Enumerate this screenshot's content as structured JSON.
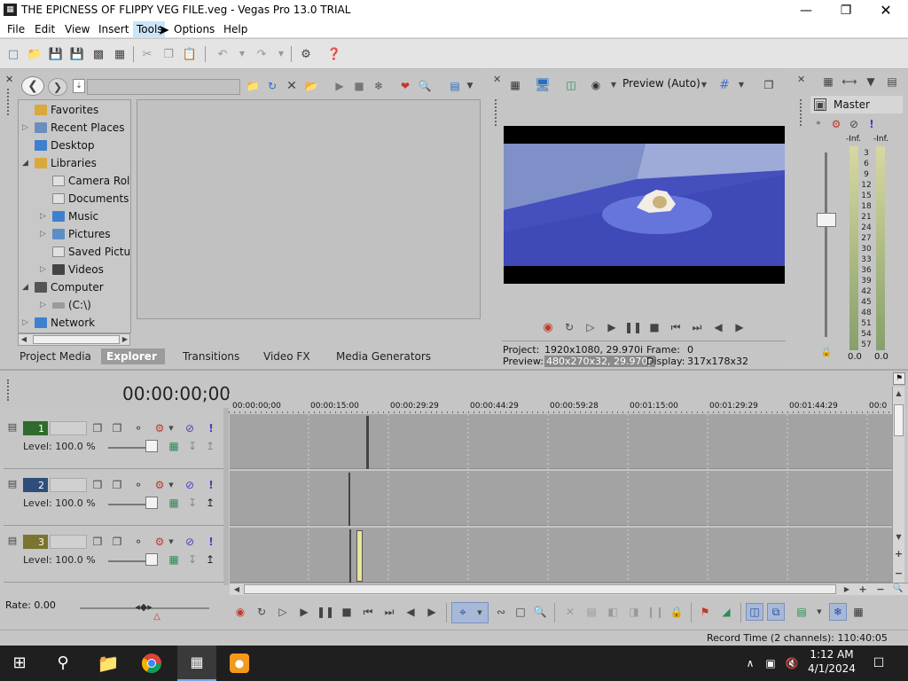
{
  "window": {
    "title": "THE EPICNESS OF FLIPPY VEG FILE.veg - Vegas Pro 13.0 TRIAL"
  },
  "menu": [
    "File",
    "Edit",
    "View",
    "Insert",
    "Tools",
    "Options",
    "Help"
  ],
  "explorer": {
    "tree": [
      {
        "label": "Favorites",
        "indent": 0,
        "expander": "",
        "icon": "star-folder-icon"
      },
      {
        "label": "Recent Places",
        "indent": 0,
        "expander": "▷",
        "icon": "recent-places-icon"
      },
      {
        "label": "Desktop",
        "indent": 0,
        "expander": "",
        "icon": "desktop-icon"
      },
      {
        "label": "Libraries",
        "indent": 0,
        "expander": "◢",
        "icon": "libraries-icon"
      },
      {
        "label": "Camera Roll",
        "indent": 1,
        "expander": "",
        "icon": "camera-roll-icon"
      },
      {
        "label": "Documents",
        "indent": 1,
        "expander": "",
        "icon": "documents-icon"
      },
      {
        "label": "Music",
        "indent": 1,
        "expander": "▷",
        "icon": "music-icon"
      },
      {
        "label": "Pictures",
        "indent": 1,
        "expander": "▷",
        "icon": "pictures-icon"
      },
      {
        "label": "Saved Pictures",
        "indent": 1,
        "expander": "",
        "icon": "saved-pictures-icon"
      },
      {
        "label": "Videos",
        "indent": 1,
        "expander": "▷",
        "icon": "videos-icon"
      },
      {
        "label": "Computer",
        "indent": 0,
        "expander": "◢",
        "icon": "computer-icon"
      },
      {
        "label": "(C:\\)",
        "indent": 1,
        "expander": "▷",
        "icon": "drive-icon"
      },
      {
        "label": "Network",
        "indent": 0,
        "expander": "▷",
        "icon": "network-icon"
      }
    ],
    "tabs": [
      "Project Media",
      "Explorer",
      "Transitions",
      "Video FX",
      "Media Generators"
    ],
    "active_tab": "Explorer"
  },
  "preview": {
    "mode_label": "Preview (Auto)",
    "project_label": "Project:",
    "project_value": "1920x1080, 29.970i",
    "frame_label": "Frame:",
    "frame_value": "0",
    "preview_label": "Preview:",
    "preview_value": "480x270x32, 29.970p",
    "display_label": "Display:",
    "display_value": "317x178x32"
  },
  "mixer": {
    "master_label": "Master",
    "inf_left": "-Inf.",
    "inf_right": "-Inf.",
    "scale": [
      "3",
      "6",
      "9",
      "12",
      "15",
      "18",
      "21",
      "24",
      "27",
      "30",
      "33",
      "36",
      "39",
      "42",
      "45",
      "48",
      "51",
      "54",
      "57"
    ],
    "level_left": "0.0",
    "level_right": "0.0"
  },
  "timeline": {
    "timecode": "00:00:00;00",
    "ruler": [
      "00:00:00;00",
      "00:00:15:00",
      "00:00:29:29",
      "00:00:44:29",
      "00:00:59:28",
      "00:01:15:00",
      "00:01:29:29",
      "00:01:44:29",
      "00:0"
    ],
    "tracks": [
      {
        "number": "1",
        "level": "Level: 100.0 %",
        "color": "#2f6b2f"
      },
      {
        "number": "2",
        "level": "Level: 100.0 %",
        "color": "#2f4d7a"
      },
      {
        "number": "3",
        "level": "Level: 100.0 %",
        "color": "#7a7430"
      }
    ]
  },
  "transport": {
    "rate": "Rate: 0.00"
  },
  "status": {
    "record_time": "Record Time (2 channels): 110:40:05"
  },
  "taskbar": {
    "time": "1:12 AM",
    "date": "4/1/2024"
  }
}
